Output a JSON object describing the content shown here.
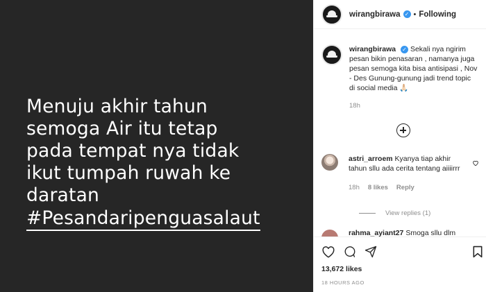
{
  "media": {
    "text": "Menuju akhir tahun\nsemoga Air itu tetap\npada tempat nya tidak\nikut tumpah ruwah ke\ndaratan",
    "hashtag": "#Pesandaripenguasalaut"
  },
  "header": {
    "username": "wirangbirawa",
    "separator": "•",
    "follow_label": "Following"
  },
  "caption": {
    "username": "wirangbirawa",
    "text": "Sekali nya ngirim pesan bikin penasaran , namanya juga pesan semoga kita bisa antisipasi , Nov - Des Gunung-gunung jadi trend topic di social media 🙏🏻",
    "time": "18h"
  },
  "comments": [
    {
      "username": "astri_arroem",
      "text": "Kyanya tiap akhir tahun sllu ada cerita tentang aiiiirrr",
      "time": "18h",
      "likes": "8 likes",
      "reply_label": "Reply",
      "view_replies": "View replies (1)"
    },
    {
      "username": "rahma_ayiant27",
      "text": "Smoga sllu dlm"
    }
  ],
  "actions": {
    "likes": "13,672 likes",
    "ago": "18 HOURS AGO"
  },
  "colors": {
    "accent": "#3897f0",
    "media_bg": "#262626",
    "muted": "#8e8e8e"
  }
}
